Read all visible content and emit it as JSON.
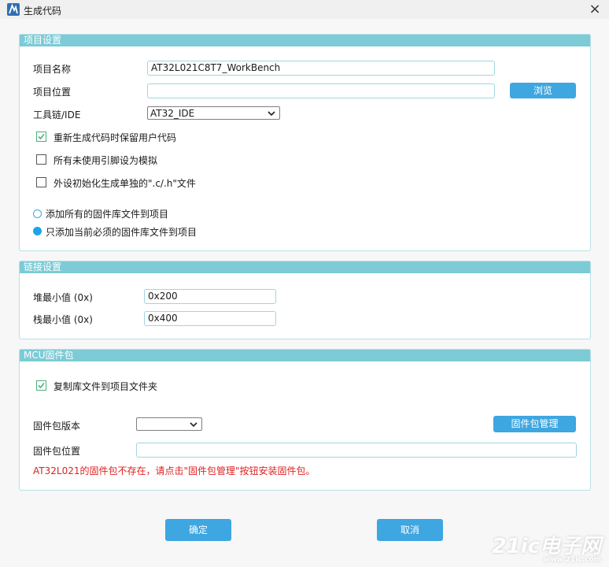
{
  "window": {
    "title": "生成代码",
    "close_icon": "×"
  },
  "project": {
    "header": "项目设置",
    "name_label": "项目名称",
    "name_value": "AT32L021C8T7_WorkBench",
    "location_label": "项目位置",
    "location_value": "",
    "browse_label": "浏览",
    "toolchain_label": "工具链/IDE",
    "toolchain_value": "AT32_IDE",
    "checkboxes": [
      {
        "label": "重新生成代码时保留用户代码",
        "checked": true
      },
      {
        "label": "所有未使用引脚设为模拟",
        "checked": false
      },
      {
        "label": "外设初始化生成单独的\".c/.h\"文件",
        "checked": false
      }
    ],
    "radios": [
      {
        "label": "添加所有的固件库文件到项目",
        "selected": false
      },
      {
        "label": "只添加当前必须的固件库文件到项目",
        "selected": true
      }
    ]
  },
  "linker": {
    "header": "链接设置",
    "heap_label": "堆最小值 (0x)",
    "heap_value": "0x200",
    "stack_label": "栈最小值 (0x)",
    "stack_value": "0x400"
  },
  "mcu": {
    "header": "MCU固件包",
    "copy_label": "复制库文件到项目文件夹",
    "copy_checked": true,
    "version_label": "固件包版本",
    "version_value": "",
    "manage_label": "固件包管理",
    "location_label": "固件包位置",
    "location_value": "",
    "error_text": "AT32L021的固件包不存在，请点击\"固件包管理\"按钮安装固件包。"
  },
  "footer": {
    "ok_label": "确定",
    "cancel_label": "取消"
  },
  "watermark": {
    "main": "21ic电子网",
    "sub": "www.21ic.com"
  },
  "colors": {
    "accent": "#3ea6e0",
    "header": "#7ccbd6",
    "error": "#e02020",
    "check": "#4db07a"
  }
}
